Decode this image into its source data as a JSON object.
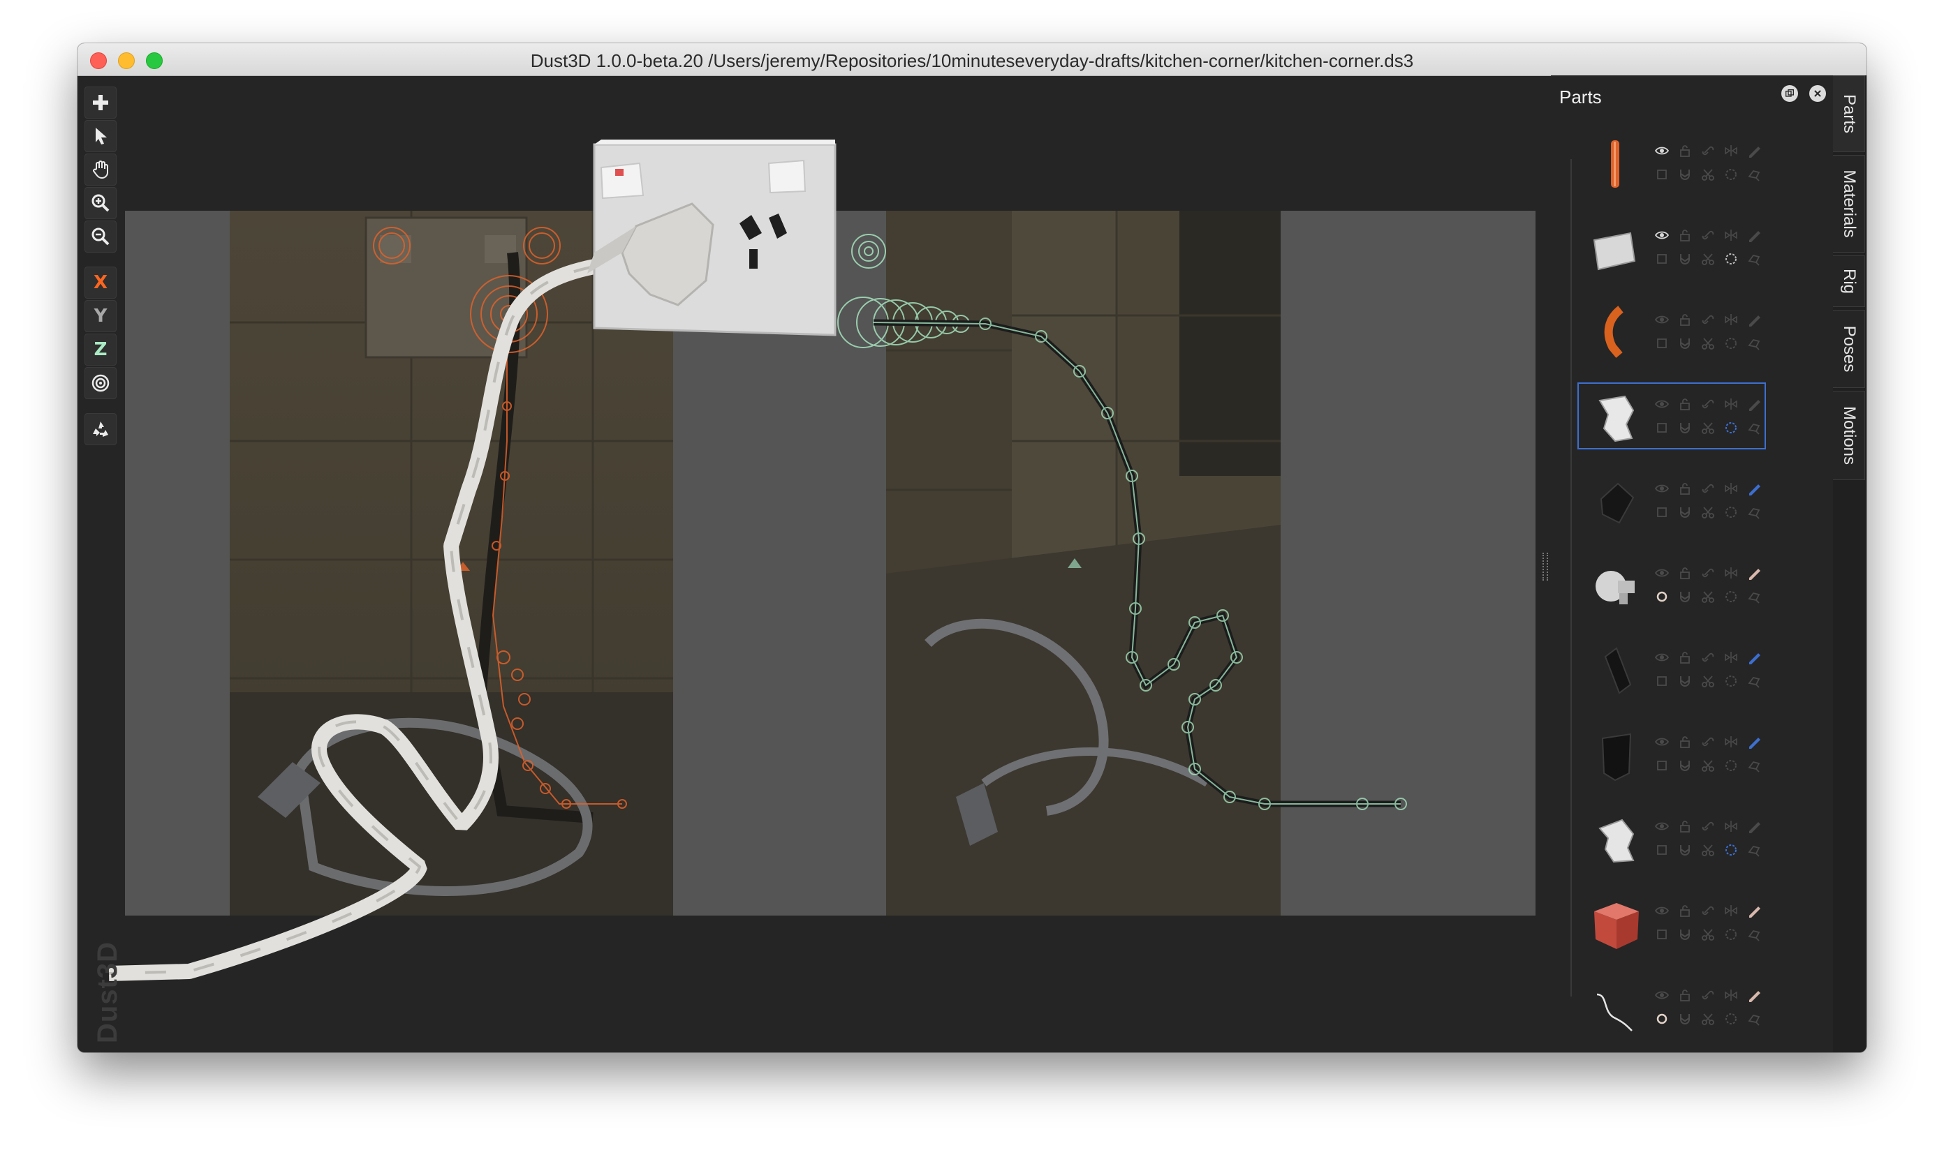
{
  "window": {
    "title": "Dust3D 1.0.0-beta.20 /Users/jeremy/Repositories/10minuteseveryday-drafts/kitchen-corner/kitchen-corner.ds3"
  },
  "toolbar": {
    "tools": [
      {
        "id": "add",
        "icon": "plus-icon"
      },
      {
        "id": "select",
        "icon": "cursor-arrow-icon"
      },
      {
        "id": "drag",
        "icon": "hand-icon"
      },
      {
        "id": "zoom-in",
        "icon": "zoom-in-icon"
      },
      {
        "id": "zoom-out",
        "icon": "zoom-out-icon"
      },
      {
        "id": "x-lock",
        "label": "X",
        "color": "#fc6621"
      },
      {
        "id": "y-lock",
        "label": "Y",
        "color": "#a8a8a8"
      },
      {
        "id": "z-lock",
        "label": "Z",
        "color": "#aaebc4"
      },
      {
        "id": "radius-lock",
        "icon": "target-icon"
      },
      {
        "id": "regenerate",
        "icon": "recycle-icon"
      }
    ],
    "brand": "Dust3D"
  },
  "parts_panel": {
    "title": "Parts",
    "float_button_icon": "float-window-icon",
    "close_button_icon": "close-icon",
    "row_controls": [
      "eye-icon",
      "lock-icon",
      "link-icon",
      "mirror-icon",
      "color-picker-icon",
      "checkbox-icon",
      "subdivide-icon",
      "cut-icon",
      "roundend-icon",
      "deform-icon"
    ],
    "parts": [
      {
        "preview": "orange-tube-part",
        "selected": false
      },
      {
        "preview": "grey-plate-part",
        "selected": false
      },
      {
        "preview": "orange-hook-part",
        "selected": false
      },
      {
        "preview": "white-bent-plug-part",
        "selected": true
      },
      {
        "preview": "black-block-part",
        "selected": false
      },
      {
        "preview": "white-cylinder-part",
        "selected": false
      },
      {
        "preview": "black-slab-part",
        "selected": false
      },
      {
        "preview": "black-box-part",
        "selected": false
      },
      {
        "preview": "white-plug-part",
        "selected": false
      },
      {
        "preview": "red-cube-part",
        "selected": false
      },
      {
        "preview": "thin-curve-part",
        "selected": false
      }
    ]
  },
  "side_tabs": [
    "Parts",
    "Materials",
    "Rig",
    "Poses",
    "Motions"
  ],
  "colors": {
    "accent_blue": "#3d6fd1",
    "axis_x": "#fc6621",
    "orange_node": "#e0622a",
    "teal_node": "#aaebc4"
  }
}
